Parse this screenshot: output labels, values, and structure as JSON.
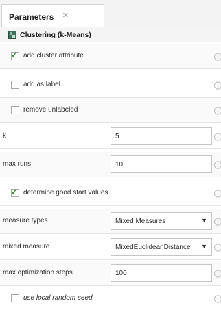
{
  "tab": {
    "title": "Parameters",
    "close_glyph": "×"
  },
  "operator": {
    "title": "Clustering (k-Means)",
    "icon": "clustering-operator-icon"
  },
  "info_glyph": "ⓘ",
  "params": {
    "add_cluster_attribute": {
      "label": "add cluster attribute",
      "checked": true
    },
    "add_as_label": {
      "label": "add as label",
      "checked": false
    },
    "remove_unlabeled": {
      "label": "remove unlabeled",
      "checked": false
    },
    "k": {
      "label": "k",
      "value": "5"
    },
    "max_runs": {
      "label": "max runs",
      "value": "10"
    },
    "determine_good_start_values": {
      "label": "determine good start values",
      "checked": true
    },
    "measure_types": {
      "label": "measure types",
      "value": "Mixed Measures"
    },
    "mixed_measure": {
      "label": "mixed measure",
      "value": "MixedEuclideanDistance"
    },
    "max_optimization_steps": {
      "label": "max optimization steps",
      "value": "100"
    },
    "use_local_random_seed": {
      "label": "use local random seed",
      "checked": false
    }
  },
  "colors": {
    "check": "#2f8f2f",
    "border": "#c5c5c5",
    "info": "#b0b0b0"
  }
}
